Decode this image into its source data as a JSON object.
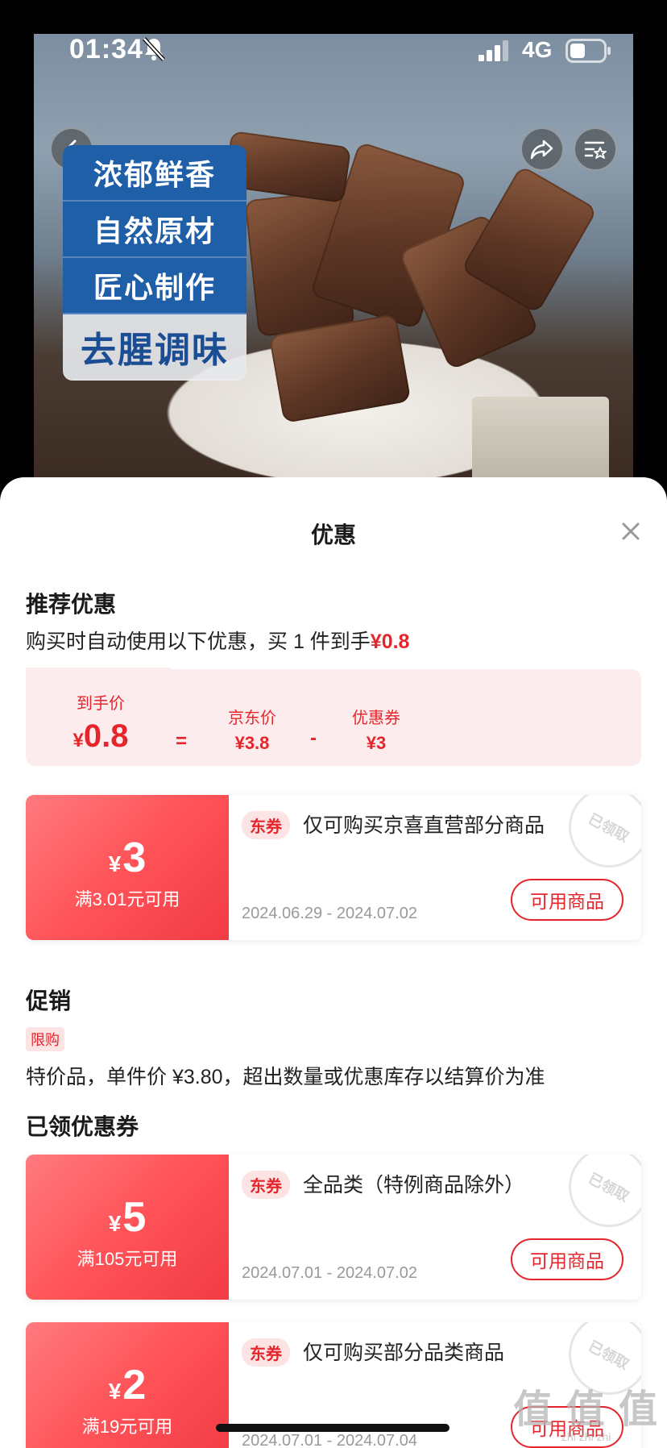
{
  "status_bar": {
    "time": "01:34",
    "network": "4G"
  },
  "product": {
    "banner": [
      "浓郁鲜香",
      "自然原材",
      "匠心制作",
      "去腥调味"
    ]
  },
  "sheet": {
    "title": "优惠",
    "recommend": {
      "heading": "推荐优惠",
      "text_prefix": "购买时自动使用以下优惠，买 1 件到手",
      "text_price": "¥0.8",
      "final_label": "到手价",
      "final_yen": "¥",
      "final_value": "0.8",
      "equals": "=",
      "jd_label": "京东价",
      "jd_value": "¥3.8",
      "minus": "-",
      "coupon_label": "优惠券",
      "coupon_value": "¥3"
    },
    "coupons_top": [
      {
        "yen": "¥",
        "amount": "3",
        "condition": "满3.01元可用",
        "tag": "东券",
        "desc": "仅可购买京喜直营部分商品",
        "date": "2024.06.29 - 2024.07.02",
        "button": "可用商品",
        "stamp": "已领取"
      }
    ],
    "promo": {
      "heading": "促销",
      "tag": "限购",
      "text": "特价品，单件价 ¥3.80，超出数量或优惠库存以结算价为准"
    },
    "claimed": {
      "heading": "已领优惠券",
      "items": [
        {
          "yen": "¥",
          "amount": "5",
          "condition": "满105元可用",
          "tag": "东券",
          "desc": "全品类（特例商品除外）",
          "date": "2024.07.01 - 2024.07.02",
          "button": "可用商品",
          "stamp": "已领取"
        },
        {
          "yen": "¥",
          "amount": "2",
          "condition": "满19元可用",
          "tag": "东券",
          "desc": "仅可购买部分品类商品",
          "date": "2024.07.01 - 2024.07.04",
          "button": "可用商品",
          "stamp": "已领取"
        }
      ]
    }
  },
  "watermark": {
    "big": "值 值 值",
    "small": "zhi zhi zhi"
  },
  "colors": {
    "accent": "#e4262c",
    "coupon_gradient_start": "#ff7a7e",
    "coupon_gradient_end": "#f23b44",
    "banner_blue": "#1f5fa8"
  },
  "icons": {
    "back": "chevron-left-icon",
    "share": "share-icon",
    "list": "list-star-icon",
    "close": "close-icon",
    "mute": "bell-slash-icon",
    "signal": "signal-icon",
    "battery": "battery-icon"
  }
}
